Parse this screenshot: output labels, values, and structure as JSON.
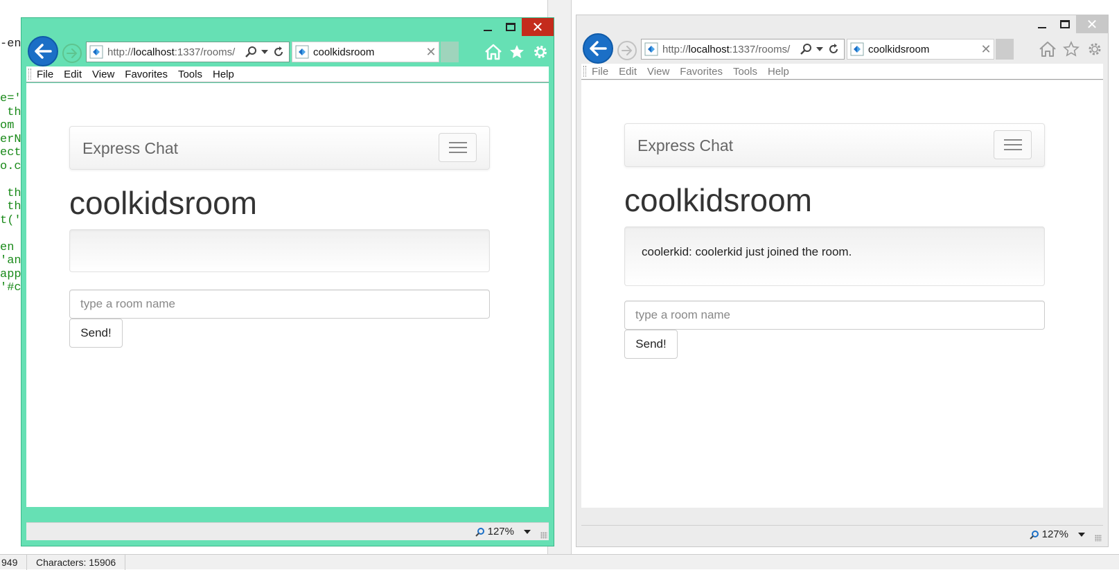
{
  "editor": {
    "lines": [
      "-end",
      "",
      "",
      "",
      "e='",
      " the",
      "om =",
      "erNa",
      "ect",
      "o.co",
      "",
      " the",
      " the",
      "t('",
      "",
      "en ",
      "'an",
      "appe",
      "'#co"
    ]
  },
  "statusbar": {
    "line_count": "949",
    "characters": "Characters: 15906"
  },
  "windows": [
    {
      "url_prefix": "http://",
      "url_host": "localhost",
      "url_rest": ":1337/rooms/",
      "tab_title": "coolkidsroom",
      "menu": [
        "File",
        "Edit",
        "View",
        "Favorites",
        "Tools",
        "Help"
      ],
      "brand": "Express Chat",
      "room_title": "coolkidsroom",
      "message": "",
      "input_placeholder": "type a room name",
      "send_label": "Send!",
      "zoom": "127%"
    },
    {
      "url_prefix": "http://",
      "url_host": "localhost",
      "url_rest": ":1337/rooms/",
      "tab_title": "coolkidsroom",
      "menu": [
        "File",
        "Edit",
        "View",
        "Favorites",
        "Tools",
        "Help"
      ],
      "brand": "Express Chat",
      "room_title": "coolkidsroom",
      "message": "coolerkid: coolerkid just joined the room.",
      "input_placeholder": "type a room name",
      "send_label": "Send!",
      "zoom": "127%"
    }
  ],
  "colors": {
    "active_frame": "#66e0b4",
    "inactive_frame": "#ececec",
    "close_active": "#c42b1c",
    "back_button": "#1b6fc6"
  }
}
